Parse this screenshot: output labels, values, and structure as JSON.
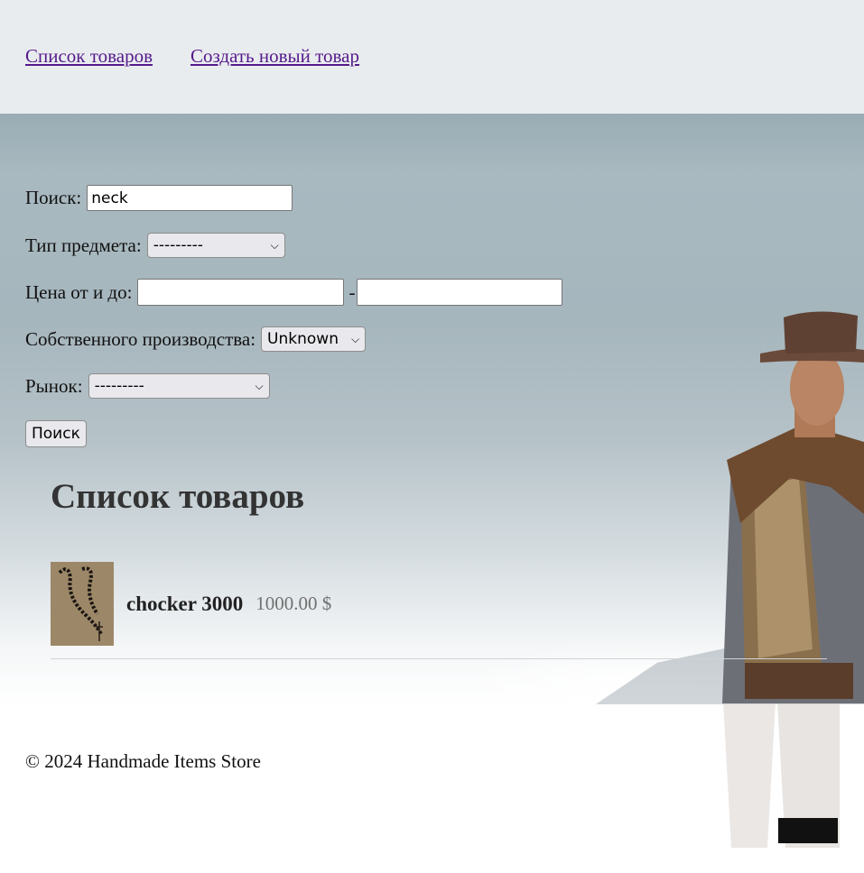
{
  "nav": {
    "products_link": "Список товаров",
    "create_link": "Создать новый товар"
  },
  "filter": {
    "search_label": "Поиск:",
    "search_value": "neck",
    "type_label": "Тип предмета:",
    "type_value": "---------",
    "price_label": "Цена от и до:",
    "price_from": "",
    "price_sep": "-",
    "price_to": "",
    "own_label": "Собственного производства:",
    "own_value": "Unknown",
    "market_label": "Рынок:",
    "market_value": "---------",
    "submit_label": "Поиск"
  },
  "list": {
    "title": "Список товаров",
    "items": [
      {
        "name": "chocker 3000",
        "price": "1000.00 $"
      }
    ]
  },
  "footer": {
    "copyright": "© 2024 Handmade Items Store"
  }
}
